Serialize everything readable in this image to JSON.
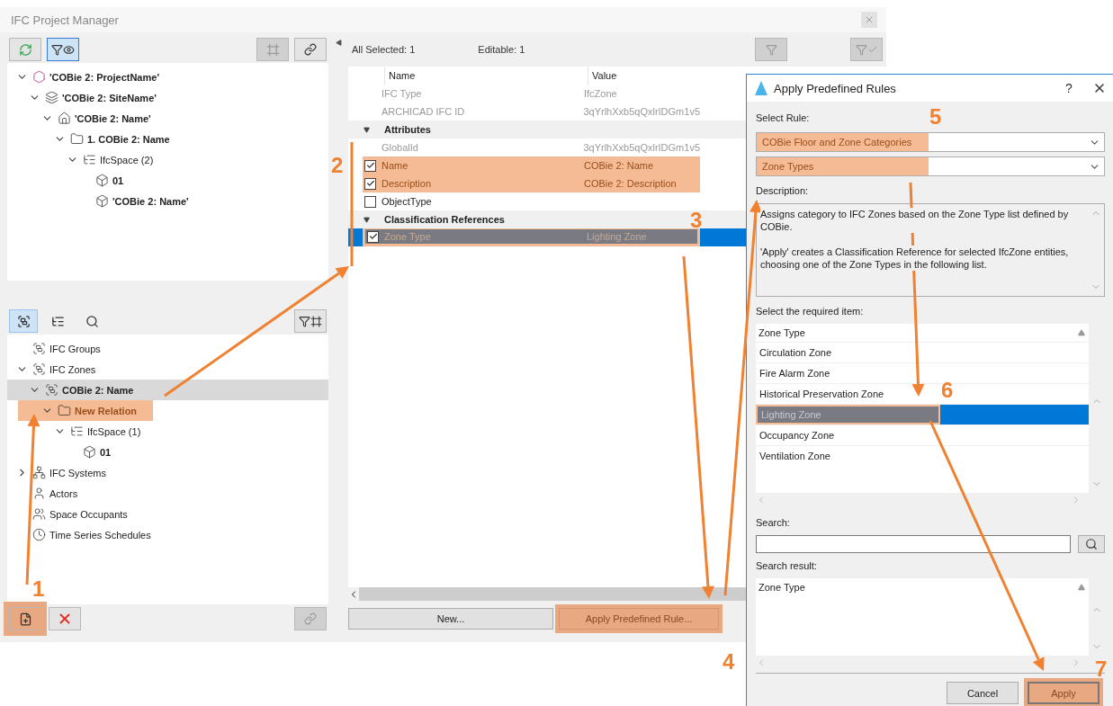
{
  "window": {
    "title": "IFC Project Manager"
  },
  "project_toolbar": [
    {
      "on": false,
      "disabled": false
    },
    {
      "on": true,
      "disabled": false
    },
    {
      "on": false,
      "disabled": true
    },
    {
      "on": false,
      "disabled": false
    }
  ],
  "project_tree": [
    {
      "label": "'COBie 2: ProjectName'",
      "kind": "project",
      "bold": true,
      "expanded": true,
      "children": [
        {
          "label": "'COBie 2: SiteName'",
          "kind": "site",
          "bold": true,
          "expanded": true,
          "children": [
            {
              "label": "'COBie 2: Name'",
              "kind": "building",
              "bold": true,
              "expanded": true,
              "children": [
                {
                  "label": "1. COBie 2: Name",
                  "kind": "storey",
                  "bold": true,
                  "expanded": true,
                  "children": [
                    {
                      "label": "IfcSpace (2)",
                      "kind": "spaces",
                      "bold": false,
                      "expanded": true,
                      "children": [
                        {
                          "label": "01",
                          "kind": "space",
                          "bold": true
                        },
                        {
                          "label": "'COBie 2: Name'",
                          "kind": "space",
                          "bold": true
                        }
                      ]
                    }
                  ]
                }
              ]
            }
          ]
        }
      ]
    }
  ],
  "relations_tabs": [
    {
      "selected": true
    },
    {
      "selected": false
    },
    {
      "selected": false
    }
  ],
  "relations_tree": [
    {
      "label": "IFC Groups",
      "kind": "groups",
      "bold": false,
      "selected": false,
      "highlighted": false
    },
    {
      "label": "IFC Zones",
      "kind": "groups",
      "bold": false,
      "selected": false,
      "highlighted": false,
      "expanded": true,
      "children": [
        {
          "label": "COBie 2: Name",
          "kind": "groups",
          "bold": true,
          "selected": true,
          "highlighted": false,
          "expanded": true,
          "children": [
            {
              "label": "New Relation",
              "kind": "relation",
              "bold": true,
              "selected": false,
              "highlighted": true,
              "expanded": true,
              "children": [
                {
                  "label": "IfcSpace (1)",
                  "kind": "spaces",
                  "bold": false,
                  "selected": false,
                  "highlighted": false,
                  "expanded": true,
                  "children": [
                    {
                      "label": "01",
                      "kind": "space",
                      "bold": true,
                      "selected": false,
                      "highlighted": false
                    }
                  ]
                }
              ]
            }
          ]
        }
      ]
    },
    {
      "label": "IFC Systems",
      "kind": "systems",
      "bold": false,
      "selected": false,
      "highlighted": false,
      "expanded": false
    },
    {
      "label": "Actors",
      "kind": "actors",
      "bold": false,
      "selected": false,
      "highlighted": false
    },
    {
      "label": "Space Occupants",
      "kind": "occupants",
      "bold": false,
      "selected": false,
      "highlighted": false
    },
    {
      "label": "Time Series Schedules",
      "kind": "schedules",
      "bold": false,
      "selected": false,
      "highlighted": false
    }
  ],
  "bottom_tools": [
    {
      "kind": "add",
      "highlighted": true,
      "disabled": false
    },
    {
      "kind": "delete",
      "highlighted": false,
      "disabled": false
    },
    {
      "kind": "link",
      "highlighted": false,
      "disabled": true
    }
  ],
  "properties": {
    "all_selected": "All Selected: 1",
    "editable": "Editable: 1",
    "columns": [
      "Name",
      "Value"
    ],
    "rows": [
      {
        "kind": "info",
        "name": "IFC Type",
        "value": "IfcZone"
      },
      {
        "kind": "info",
        "name": "ARCHICAD IFC ID",
        "value": "3qYrlhXxb5qQxlrIDGm1v5"
      },
      {
        "kind": "group",
        "name": "Attributes",
        "expanded": true
      },
      {
        "kind": "info",
        "name": "GlobalId",
        "value": "3qYrlhXxb5qQxlrIDGm1v5"
      },
      {
        "kind": "attribute",
        "name": "Name",
        "value": "COBie 2: Name",
        "checked": true,
        "selected": false,
        "highlighted": true
      },
      {
        "kind": "attribute",
        "name": "Description",
        "value": "COBie 2: Description",
        "checked": true,
        "selected": false,
        "highlighted": true
      },
      {
        "kind": "attribute",
        "name": "ObjectType",
        "checked": false,
        "selected": false,
        "highlighted": false
      },
      {
        "kind": "group",
        "name": "Classification References",
        "expanded": true
      },
      {
        "kind": "attribute",
        "name": "Zone Type",
        "value": "Lighting Zone",
        "checked": true,
        "selected": true,
        "highlighted": true
      }
    ]
  },
  "buttons": [
    {
      "label": "New...",
      "highlighted": false
    },
    {
      "label": "Apply Predefined Rule...",
      "highlighted": true
    }
  ],
  "dialog": {
    "title": "Apply Predefined Rules",
    "help": "?",
    "select_rule_label": "Select Rule:",
    "rule_dropdowns": [
      {
        "value": "COBie Floor and Zone Categories",
        "highlighted": true
      },
      {
        "value": "Zone Types",
        "highlighted": true
      }
    ],
    "description_label": "Description:",
    "description": [
      "Assigns category to IFC Zones based on the Zone Type list defined by COBie.",
      "'Apply' creates a Classification Reference for selected IfcZone entities, choosing one of the Zone Types in the following list."
    ],
    "required_label": "Select the required item:",
    "list_header": "Zone Type",
    "items": [
      {
        "label": "Circulation Zone",
        "selected": false,
        "highlighted": false
      },
      {
        "label": "Fire Alarm Zone",
        "selected": false,
        "highlighted": false
      },
      {
        "label": "Historical Preservation Zone",
        "selected": false,
        "highlighted": false
      },
      {
        "label": "Lighting Zone",
        "selected": true,
        "highlighted": true
      },
      {
        "label": "Occupancy Zone",
        "selected": false,
        "highlighted": false
      },
      {
        "label": "Ventilation Zone",
        "selected": false,
        "highlighted": false
      }
    ],
    "search_label": "Search:",
    "search_result_label": "Search result:",
    "result_header": "Zone Type",
    "buttons": [
      {
        "label": "Cancel",
        "highlighted": false
      },
      {
        "label": "Apply",
        "highlighted": true
      }
    ]
  },
  "annotations": {
    "steps": [
      "1",
      "2",
      "3",
      "4",
      "5",
      "6",
      "7"
    ]
  }
}
